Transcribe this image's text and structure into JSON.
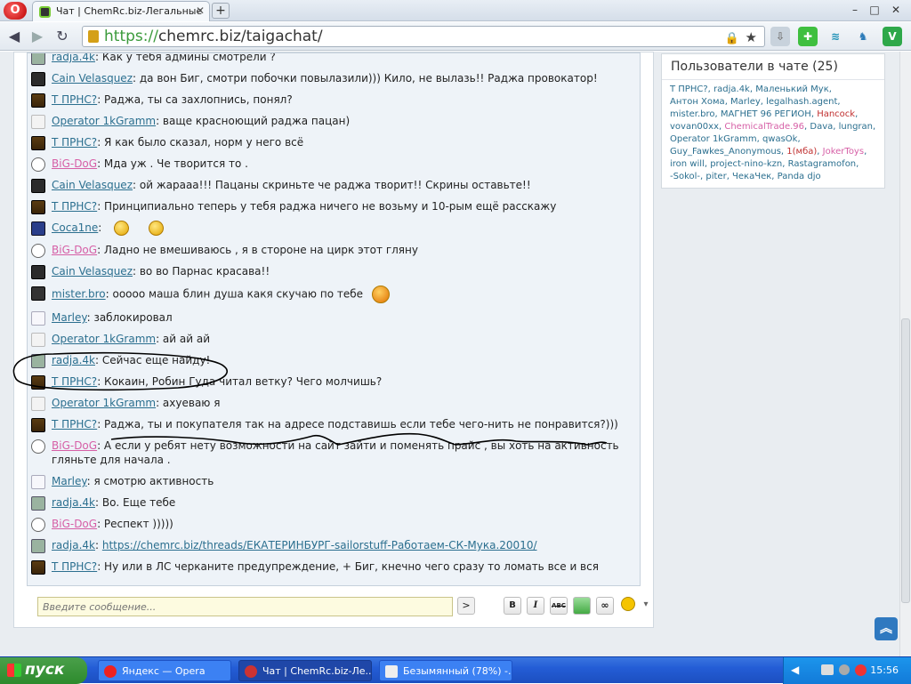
{
  "browser": {
    "tab_title": "Чат | ChemRc.biz-Легальные",
    "url_protocol": "https://",
    "url_rest": "chemrc.biz/taigachat/",
    "new_tab": "+",
    "win_min": "–",
    "win_max": "□",
    "win_close": "✕"
  },
  "chat": {
    "messages": [
      {
        "user": "radja.4k",
        "text": ": Как у тебя админы смотрели ?",
        "avatar": "radja",
        "color": "plain"
      },
      {
        "user": "Cain Velasquez",
        "text": ": да вон Биг, смотри побочки повылазили))) Кило, не вылазь!! Раджа провокатор!",
        "avatar": "cain",
        "color": "plain"
      },
      {
        "user": "Т ПРНС?",
        "text": ": Раджа, ты са захлопнись, понял?",
        "avatar": "tprns",
        "color": "plain"
      },
      {
        "user": "Operator 1kGramm",
        "text": ": ваще красноющий раджа пацан)",
        "avatar": "op",
        "color": "plain"
      },
      {
        "user": "Т ПРНС?",
        "text": ": Я как было сказал, норм у него всё",
        "avatar": "tprns",
        "color": "plain"
      },
      {
        "user": "BiG-DoG",
        "text": ": Мда уж . Че творится то .",
        "avatar": "big",
        "color": "pink"
      },
      {
        "user": "Cain Velasquez",
        "text": ": ой жарааа!!! Пацаны скриньте че раджа творит!! Скрины оставьте!!",
        "avatar": "cain",
        "color": "plain"
      },
      {
        "user": "Т ПРНС?",
        "text": ": Принципиально теперь у тебя раджа ничего не возьму и 10-рым ещё расскажу",
        "avatar": "tprns",
        "color": "plain"
      },
      {
        "user": "Coca1ne",
        "text": ":",
        "avatar": "coca",
        "color": "plain",
        "smiles": 2
      },
      {
        "user": "BiG-DoG",
        "text": ": Ладно не вмешиваюсь , я в стороне на цирк этот гляну",
        "avatar": "big",
        "color": "pink"
      },
      {
        "user": "Cain Velasquez",
        "text": ": во во Парнас красава!!",
        "avatar": "cain",
        "color": "plain"
      },
      {
        "user": "mister.bro",
        "text": ": ооооо маша блин душа какя скучаю по тебе",
        "avatar": "mister",
        "color": "plain",
        "bigsmile": true
      },
      {
        "user": "Marley",
        "text": ": заблокировал",
        "avatar": "marley",
        "color": "plain"
      },
      {
        "user": "Operator 1kGramm",
        "text": ": ай ай ай",
        "avatar": "op",
        "color": "plain"
      },
      {
        "user": "radja.4k",
        "text": ": Сейчас еще найду!",
        "avatar": "radja",
        "color": "plain"
      },
      {
        "user": "Т ПРНС?",
        "text": ": Кокаин, Робин Гуда читал ветку? Чего молчишь?",
        "avatar": "tprns",
        "color": "plain"
      },
      {
        "user": "Operator 1kGramm",
        "text": ": ахуеваю я",
        "avatar": "op",
        "color": "plain"
      },
      {
        "user": "Т ПРНС?",
        "text": ": Раджа, ты и покупателя так на адресе подставишь если тебе чего-нить не понравится?)))",
        "avatar": "tprns",
        "color": "plain"
      },
      {
        "user": "BiG-DoG",
        "text": ": А если у ребят нету возможности на сайт зайти и поменять прайс , вы хоть на активность гляньте для начала .",
        "avatar": "big",
        "color": "pink"
      },
      {
        "user": "Marley",
        "text": ": я смотрю активность",
        "avatar": "marley",
        "color": "plain"
      },
      {
        "user": "radja.4k",
        "text": ": Во. Еще тебе",
        "avatar": "radja",
        "color": "plain"
      },
      {
        "user": "BiG-DoG",
        "text": ": Респект )))))",
        "avatar": "big",
        "color": "pink"
      },
      {
        "user": "radja.4k",
        "text": ": ",
        "avatar": "radja",
        "color": "plain",
        "link": "https://chemrc.biz/threads/ЕКАТЕРИНБУРГ-sailorstuff-Работаем-СК-Мука.20010/"
      },
      {
        "user": "Т ПРНС?",
        "text": ": Ну или в ЛС черканите предупреждение, + Биг, кнечно чего сразу то ломать все и вся",
        "avatar": "tprns",
        "color": "plain"
      }
    ],
    "input_placeholder": "Введите сообщение...",
    "send_label": ">",
    "format_buttons": [
      "B",
      "I",
      "ABC",
      "img",
      "link"
    ]
  },
  "users_panel": {
    "title": "Пользователи в чате (25)",
    "users": [
      {
        "name": "Т ПРНС?",
        "c": ""
      },
      {
        "name": "radja.4k",
        "c": ""
      },
      {
        "name": "Маленький Мук",
        "c": ""
      },
      {
        "name": "Антон Хома",
        "c": ""
      },
      {
        "name": "Marley",
        "c": ""
      },
      {
        "name": "legalhash.agent",
        "c": ""
      },
      {
        "name": "mister.bro",
        "c": ""
      },
      {
        "name": "МАГНЕТ 96 РЕГИОН",
        "c": ""
      },
      {
        "name": "Hancock",
        "c": "u-red"
      },
      {
        "name": "vovan00xx",
        "c": ""
      },
      {
        "name": "ChemicalTrade.96",
        "c": "u-pink"
      },
      {
        "name": "Dava",
        "c": ""
      },
      {
        "name": "lungran",
        "c": ""
      },
      {
        "name": "Operator 1kGramm",
        "c": ""
      },
      {
        "name": "qwasOk",
        "c": ""
      },
      {
        "name": "Guy_Fawkes_Anonymous",
        "c": ""
      },
      {
        "name": "1(мба)",
        "c": "u-red"
      },
      {
        "name": "JokerToys",
        "c": "u-pink"
      },
      {
        "name": "iron will",
        "c": ""
      },
      {
        "name": "project-nino-kzn",
        "c": ""
      },
      {
        "name": "Rastagramofon",
        "c": ""
      },
      {
        "name": "-Sokol-",
        "c": ""
      },
      {
        "name": "piter",
        "c": ""
      },
      {
        "name": "ЧекаЧек",
        "c": ""
      },
      {
        "name": "Panda djo",
        "c": ""
      }
    ]
  },
  "taskbar": {
    "start_label": "пуск",
    "tasks": [
      "Яндекс — Opera",
      "Чат | ChemRc.biz-Ле...",
      "Безымянный (78%) -..."
    ],
    "clock": "15:56"
  }
}
